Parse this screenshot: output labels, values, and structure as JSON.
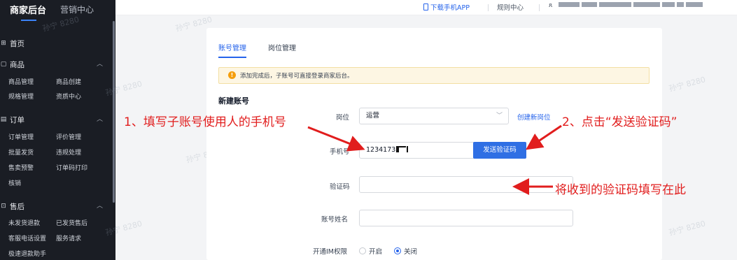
{
  "sidebar": {
    "brand_active": "商家后台",
    "brand_other": "营销中心",
    "home": "首页",
    "groups": [
      {
        "label": "商品",
        "items": [
          "商品管理",
          "商品创建",
          "规格管理",
          "资质中心"
        ]
      },
      {
        "label": "订单",
        "items": [
          "订单管理",
          "评价管理",
          "批量发货",
          "违规处理",
          "售卖预警",
          "订单码打印",
          "核销"
        ]
      },
      {
        "label": "售后",
        "items": [
          "未发货退款",
          "已发货售后",
          "客服电话设置",
          "服务请求",
          "极速退款助手"
        ]
      }
    ]
  },
  "topbar": {
    "download_app": "下载手机APP",
    "rules_center": "规则中心"
  },
  "tabs": [
    "账号管理",
    "岗位管理"
  ],
  "notice": "添加完成后，子账号可直接登录商家后台。",
  "form": {
    "section_title": "新建账号",
    "position_label": "岗位",
    "position_value": "运营",
    "create_position": "创建新岗位",
    "phone_label": "手机号",
    "phone_value": "1234173",
    "send_code": "发送验证码",
    "code_label": "验证码",
    "name_label": "账号姓名",
    "im_label": "开通IM权限",
    "im_on": "开启",
    "im_off": "关闭"
  },
  "watermark": "孙宁 8280",
  "annotations": {
    "step1": "1、填写子账号使用人的手机号",
    "step2": "2、点击“发送验证码”",
    "step3": "将收到的验证码填写在此"
  },
  "colors": {
    "accent": "#2563eb",
    "annotation": "#e11d1d",
    "sidebar_bg": "#1a1d24"
  }
}
